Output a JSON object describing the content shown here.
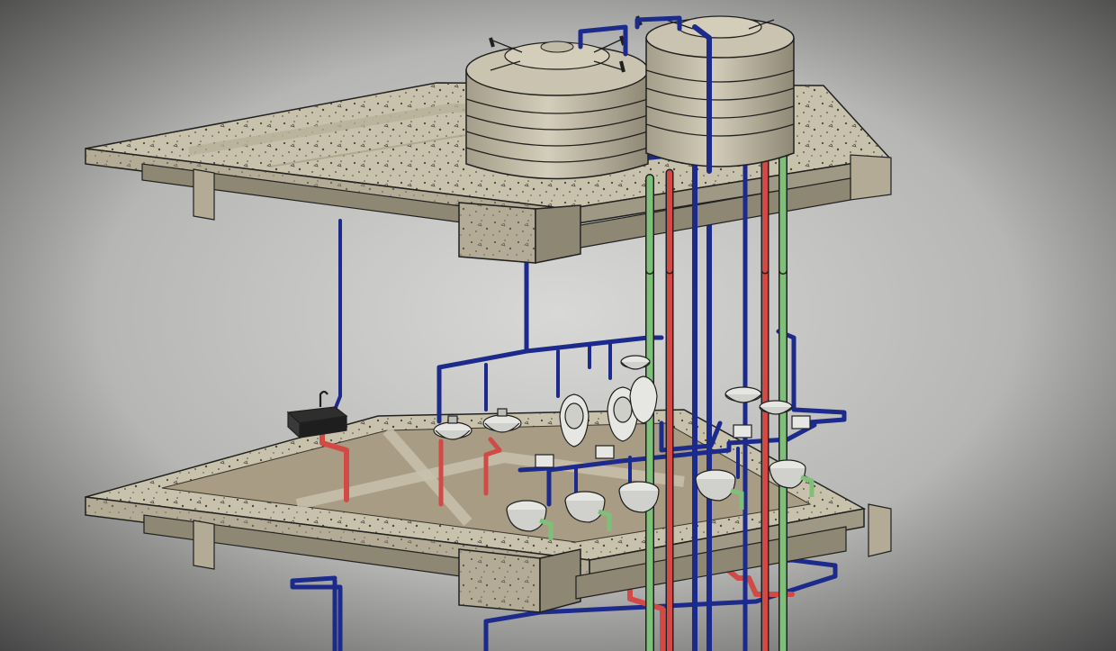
{
  "scene": {
    "subject": "plumbing-isometric-model",
    "colors": {
      "background_center": "#d8d8d6",
      "background_edge": "#3c3c3c",
      "slab_top": "#c8c1ac",
      "slab_side": "#b3ab95",
      "slab_dark": "#8e8773",
      "floor_inset": "#a89c85",
      "tank": "#cdc7b4",
      "tank_shade": "#9f9885",
      "water_supply": "#1c2a8c",
      "hot_water": "#d24a45",
      "vent_pipe": "#7ec07a",
      "fixture": "#e6e6e2",
      "outline": "#202020"
    }
  }
}
